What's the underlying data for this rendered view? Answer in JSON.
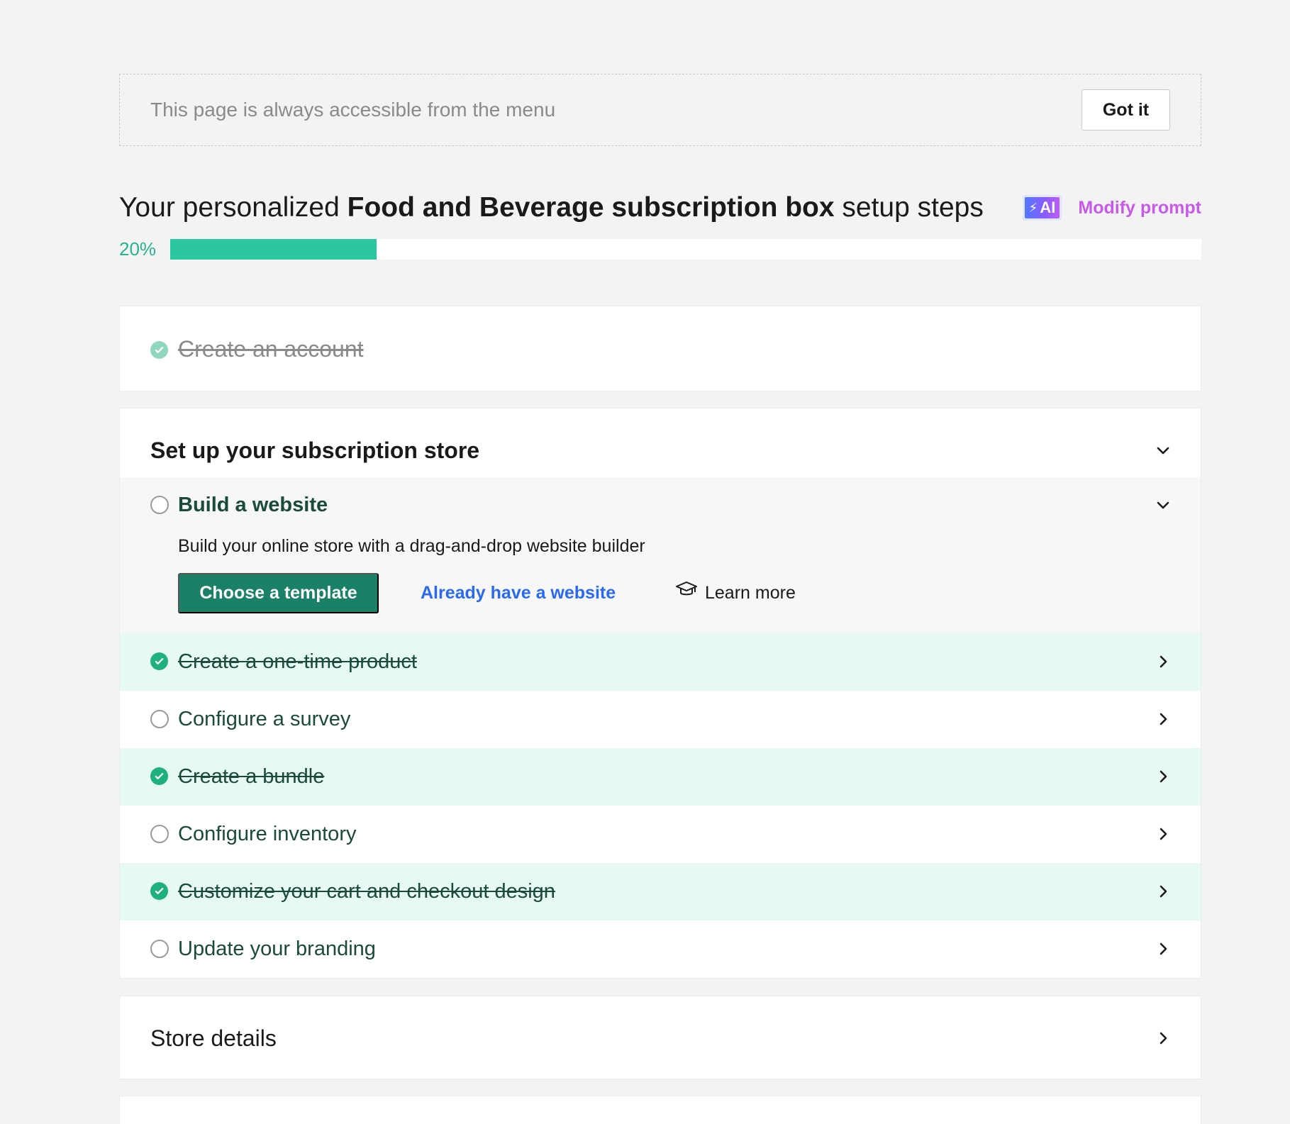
{
  "notice": {
    "text": "This page is always accessible from the menu",
    "button_label": "Got it"
  },
  "heading": {
    "prefix": "Your personalized ",
    "emphasis": "Food and Beverage subscription box",
    "suffix": " setup steps"
  },
  "ai": {
    "badge_label": "AI",
    "badge_icon": "lightning-bolt-icon",
    "modify_label": "Modify prompt"
  },
  "progress": {
    "label": "20%",
    "fraction": 0.2,
    "color": "#2ac7a0"
  },
  "account_step": {
    "label": "Create an account",
    "completed": true
  },
  "setup_section": {
    "title": "Set up your subscription store",
    "expanded": true,
    "build_website": {
      "title": "Build a website",
      "description": "Build your online store with a drag-and-drop website builder",
      "primary_button": "Choose a template",
      "secondary_link": "Already have a website",
      "learn_more": "Learn more"
    },
    "tasks": [
      {
        "label": "Create a one-time product",
        "completed": true
      },
      {
        "label": "Configure a survey",
        "completed": false
      },
      {
        "label": "Create a bundle",
        "completed": true
      },
      {
        "label": "Configure inventory",
        "completed": false
      },
      {
        "label": "Customize your cart and checkout design",
        "completed": true
      },
      {
        "label": "Update your branding",
        "completed": false
      }
    ]
  },
  "store_details": {
    "title": "Store details"
  },
  "colors": {
    "accent_green": "#1a8066",
    "completed_row_bg": "#e6f9f2",
    "check_green": "#1fb07f",
    "link_blue": "#2a6af0",
    "modify_purple": "#c65bea"
  }
}
